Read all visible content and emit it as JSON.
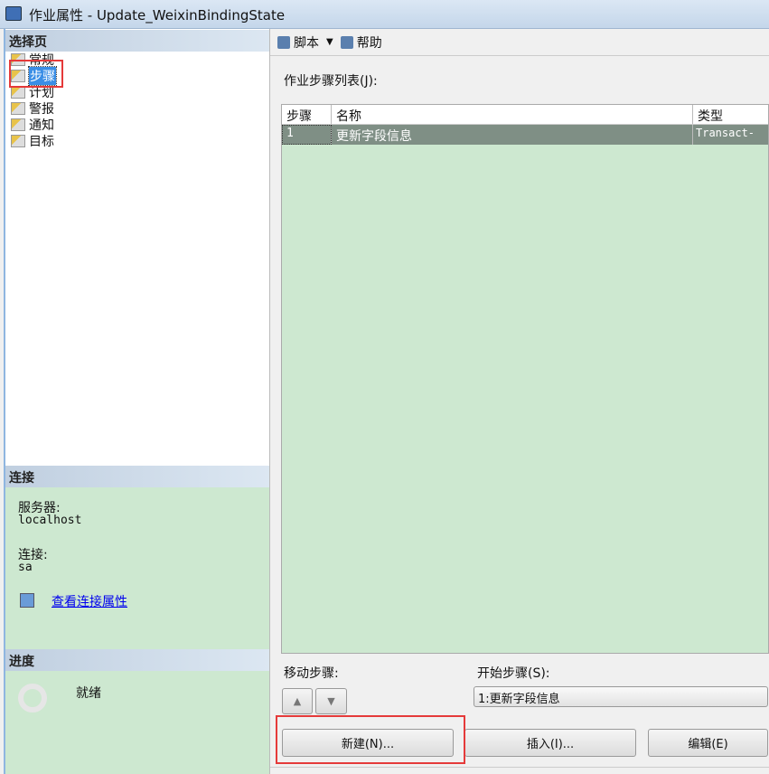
{
  "window": {
    "title": "作业属性 - Update_WeixinBindingState"
  },
  "left": {
    "select_page_header": "选择页",
    "pages": [
      {
        "label": "常规"
      },
      {
        "label": "步骤",
        "selected": true
      },
      {
        "label": "计划"
      },
      {
        "label": "警报"
      },
      {
        "label": "通知"
      },
      {
        "label": "目标"
      }
    ],
    "connection_header": "连接",
    "server_label": "服务器:",
    "server_value": "localhost",
    "connection_label": "连接:",
    "connection_value": "sa",
    "view_connection_link": "查看连接属性",
    "progress_header": "进度",
    "progress_status": "就绪"
  },
  "toolbar": {
    "script_label": "脚本",
    "help_label": "帮助"
  },
  "main": {
    "list_label": "作业步骤列表(J):",
    "columns": [
      "步骤",
      "名称",
      "类型"
    ],
    "rows": [
      {
        "step": "1",
        "name": "更新字段信息",
        "type": "Transact-"
      }
    ],
    "move_step_label": "移动步骤:",
    "start_step_label": "开始步骤(S):",
    "start_step_value": "1:更新字段信息",
    "new_button": "新建(N)...",
    "insert_button": "插入(I)...",
    "edit_button": "编辑(E)"
  },
  "colors": {
    "list_bg": "#cde8d0",
    "selected_row": "#7f8f85",
    "highlight_box": "#e53a3a"
  }
}
